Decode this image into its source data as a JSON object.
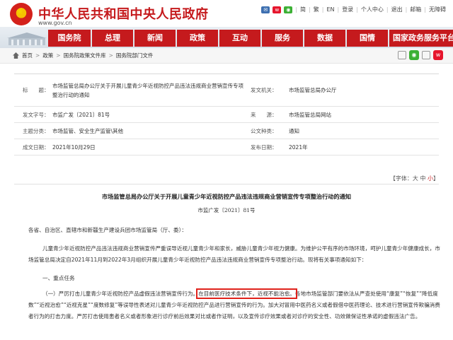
{
  "header": {
    "site_title": "中华人民共和国中央人民政府",
    "site_domain": "www.gov.cn",
    "top_links": [
      "简",
      "繁",
      "EN",
      "登录",
      "个人中心",
      "退出",
      "邮箱",
      "无障碍"
    ],
    "weibo_icon": "weibo-icon",
    "wechat_icon": "wechat-icon",
    "colors": {
      "brand_red": "#c51a1d"
    }
  },
  "nav": {
    "items": [
      "国务院",
      "总理",
      "新闻",
      "政策",
      "互动",
      "服务",
      "数据",
      "国情",
      "国家政务服务平台"
    ]
  },
  "breadcrumb": {
    "items": [
      "首页",
      "政策",
      "国务院政策文件库",
      "国务院部门文件"
    ]
  },
  "info": {
    "title_label": "标　　题：",
    "title_value": "市场监管总局办公厅关于开展儿童青少年近视防控产品违法违规商业营销宣传专项整治行动的通知",
    "issuer_label": "发文机关：",
    "issuer_value": "市场监管总局办公厅",
    "docno_label": "发文字号：",
    "docno_value": "市监广发〔2021〕81号",
    "source_label": "来　　源：",
    "source_value": "市场监管总局网站",
    "category_label": "主题分类：",
    "category_value": "市场监管、安全生产监管\\其他",
    "type_label": "公文种类：",
    "type_value": "通知",
    "written_label": "成文日期：",
    "written_value": "2021年10月29日",
    "published_label": "发布日期：",
    "published_value": "2021年"
  },
  "font_size": {
    "prefix": "【字体：",
    "large": "大",
    "medium": "中",
    "small": "小",
    "suffix": "】"
  },
  "article": {
    "title": "市场监管总局办公厅关于开展儿童青少年近视防控产品违法违规商业营销宣传专项整治行动的通知",
    "doc_no": "市监广发〔2021〕81号",
    "addressee": "各省、自治区、直辖市和新疆生产建设兵团市场监管局（厅、委）：",
    "para1": "儿童青少年近视防控产品违法违规商业营销宣传严重误导近视儿童青少年和家长，威胁儿童青少年视力健康。为维护公平有序的市场环境，呵护儿童青少年健康成长，市场监管总局决定自2021年11月到2022年3月组织开展儿童青少年近视防控产品违法违规商业营销宣传专项整治行动。现将有关事项通知如下：",
    "section1": "一、重点任务",
    "item1_a": "（一）严厉打击儿童青少年近视防控产品虚假违法营销宣传行为。",
    "item1_highlight": "在目前医疗技术条件下，近视不能治愈。",
    "item1_b": "各地市场监管部门要依法从严查处使用“康复”“恢复”“降低度数”“近视治愈”“近视克星”“度数修复”等误导性表述对儿童青少年近视防控产品进行营销宣传的行为。加大对冒用中医药名义或者假借中医药理论、技术进行营销宣传欺骗消费者行为的打击力度。严厉打击使用患者名义或者形象进行诊疗前后效果对比或者作证明，以及宣传诊疗效果或者对诊疗的安全性、功效做保证性承诺的虚假违法广告。"
  }
}
